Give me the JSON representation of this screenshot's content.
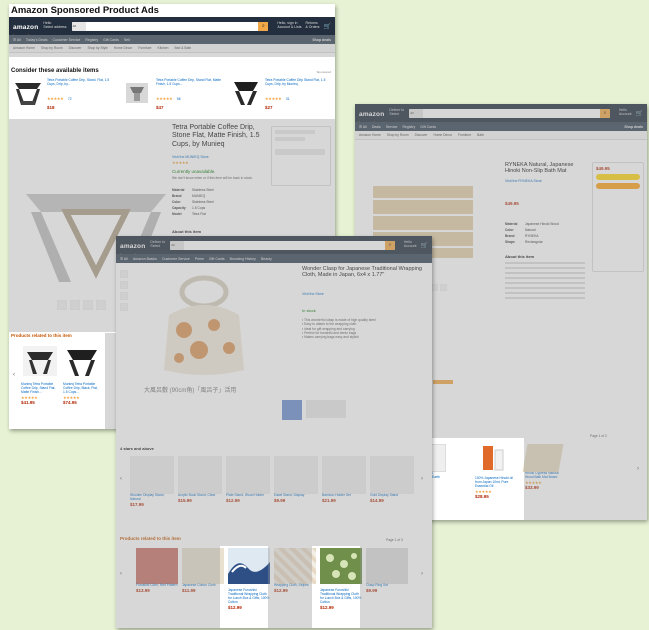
{
  "page_title": "Amazon Sponsored Product Ads",
  "colors": {
    "background": "#e6f2d3",
    "nav": "#232f3e",
    "subnav": "#37475a",
    "search_button": "#f3a847",
    "link": "#0066c0",
    "price": "#b12704",
    "sponsored_heading": "#c45500",
    "star": "#f0a13a"
  },
  "icons": [
    "search-icon",
    "cart-icon",
    "menu-icon",
    "chevron-left-icon",
    "chevron-right-icon"
  ],
  "amazon_logo": "amazon",
  "shot1": {
    "consider_heading": "Consider these available items",
    "sponsored_label": "Sponsored",
    "items": [
      {
        "title": "Tetra Portable Coffee Drip, Stand, Flat, 1.5 Cups, Drip, by...",
        "stars": "★★★★★",
        "reviews": "72",
        "price": "$18"
      },
      {
        "title": "Tetra Portable Coffee Drip, Stand Flat, Matte Finish, 1.5 Cups...",
        "stars": "★★★★★",
        "reviews": "56",
        "price": "$47"
      },
      {
        "title": "Tetra Portable Coffee Drip Stand Flat, 1.5 Cups, Drip, by Munieq",
        "stars": "★★★★★",
        "reviews": "31",
        "price": "$27"
      }
    ],
    "product_title": "Tetra Portable Coffee Drip, Stone Flat, Matte Finish, 1.5 Cups, by Munieq",
    "brand": "Visit the MUNIEQ Store",
    "rating": "★★★★★",
    "availability": "Currently unavailable.",
    "availability_note": "We don't know when or if this item will be back in stock.",
    "specs": [
      {
        "k": "Material",
        "v": "Stainless Steel"
      },
      {
        "k": "Brand",
        "v": "MUNIEQ"
      },
      {
        "k": "Color",
        "v": "Stainless Steel"
      },
      {
        "k": "Capacity",
        "v": "1.5 Cups"
      },
      {
        "k": "Model",
        "v": "Tetra Flat"
      }
    ],
    "about": "About this item",
    "related_heading": "Products related to this item",
    "related": [
      {
        "title": "Munieq Tetra Portable Coffee Drip, Stand Flat, Matte Finish...",
        "stars": "★★★★★",
        "price": "$41.95"
      },
      {
        "title": "Munieq Tetra Portable Coffee Drip, Black, Flat, 1.5 Cups...",
        "stars": "★★★★★",
        "price": "$74.95"
      }
    ]
  },
  "shot2": {
    "product_title": "Wonder Clasp for Japanese Traditional Wrapping Cloth, Made in Japan, 6x4 x 1.77\"",
    "brand": "Visit the Store",
    "availability": "In stock",
    "image_caption": "大風呂敷 (90cm角)「風呂子」活用",
    "bullets": [
      "This wonderful clasp is made of high quality steel",
      "Easy to attach to the wrapping cloth",
      "Ideal for gift wrapping and carrying",
      "Perfect for furoshiki and bento bags",
      "Makes carrying bags easy and stylish"
    ],
    "also_heading": "4 stars and above",
    "also": [
      {
        "title": "Wooden Display Stand, Natural",
        "price": "$17.99"
      },
      {
        "title": "Acrylic Book Stand, Clear",
        "price": "$15.99"
      },
      {
        "title": "Plate Stand, Wood Holder",
        "price": "$12.99"
      },
      {
        "title": "Easel Stand, Display",
        "price": "$9.99"
      },
      {
        "title": "Bamboo Holder Set",
        "price": "$21.99"
      },
      {
        "title": "Gold Display Stand",
        "price": "$14.99"
      }
    ],
    "related_heading": "Products related to this item",
    "related_page": "Page 1 of 3",
    "related": [
      {
        "title": "Furoshiki Cloth, Red Pattern",
        "price": "$13.99"
      },
      {
        "title": "Japanese Cotton Cloth",
        "price": "$11.99"
      },
      {
        "title": "Japanese Furoshiki Traditional Wrapping Cloth for Lunch Box & Gifts, 100% Cotton",
        "price": "$12.99"
      },
      {
        "title": "Wrapping Cloth, Stripes",
        "price": "$12.99"
      },
      {
        "title": "Japanese Furoshiki Traditional Wrapping Cloth for Lunch Box & Gifts, 100% Cotton",
        "price": "$12.99"
      },
      {
        "title": "Clasp Ring Set",
        "price": "$9.99"
      }
    ]
  },
  "shot3": {
    "product_title": "RYNEKA Natural, Japanese Hinoki Non-Slip Bath Mat",
    "brand": "Visit the RYNEKA Store",
    "price": "$49.95",
    "specs": [
      {
        "k": "Material",
        "v": "Japanese Hinoki Wood"
      },
      {
        "k": "Color",
        "v": "Natural"
      },
      {
        "k": "Brand",
        "v": "RYNEKA"
      },
      {
        "k": "Shape",
        "v": "Rectangular"
      }
    ],
    "about": "About this item",
    "bundle_heading": "Frequently bought together",
    "related_heading": "Products related to this item",
    "related_page": "Page 1 of 2",
    "related": [
      {
        "title": "Hinoki Japanese Cypress Wood Cutting Board, Large",
        "stars": "★★★★★",
        "price": "$65.95"
      },
      {
        "title": "White Bath Mat, Diatomaceous Earth",
        "stars": "★★★★★",
        "price": "$32.99"
      },
      {
        "title": "100% Japanese Hinoki oil from Japan 10ml, Pure Essential Oil",
        "stars": "★★★★★",
        "price": "$28.95"
      },
      {
        "title": "Hinoki Cypress Natural Wood Bath Mat Board",
        "stars": "★★★★★",
        "price": "$33.99"
      }
    ]
  }
}
